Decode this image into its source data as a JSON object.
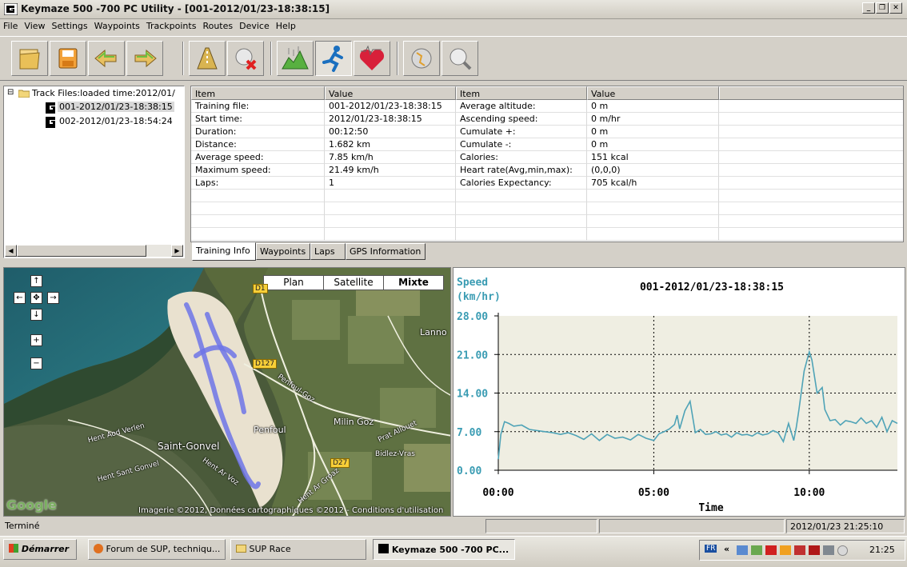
{
  "window": {
    "title": "Keymaze 500 -700 PC Utility - [001-2012/01/23-18:38:15]",
    "controls": [
      "_",
      "❐",
      "✕"
    ]
  },
  "menu": [
    "File",
    "View",
    "Settings",
    "Waypoints",
    "Trackpoints",
    "Routes",
    "Device",
    "Help"
  ],
  "toolbar": {
    "icons": [
      "open-folder-icon",
      "save-disk-icon",
      "download-arrow-icon",
      "upload-arrow-icon",
      "route-icon",
      "delete-icon",
      "altitude-chart-icon",
      "runner-icon",
      "heart-rate-icon",
      "globe-icon",
      "map-search-icon"
    ]
  },
  "tree": {
    "root_label": "Track Files:loaded time:2012/01/",
    "expander": "⊟",
    "items": [
      {
        "label": "001-2012/01/23-18:38:15"
      },
      {
        "label": "002-2012/01/23-18:54:24"
      }
    ]
  },
  "grid": {
    "headers": [
      "Item",
      "Value",
      "Item",
      "Value"
    ],
    "rows": [
      [
        "Training file:",
        "001-2012/01/23-18:38:15",
        "Average altitude:",
        "0 m"
      ],
      [
        "Start time:",
        "2012/01/23-18:38:15",
        "Ascending speed:",
        "0    m/hr"
      ],
      [
        "Duration:",
        "00:12:50",
        "Cumulate +:",
        "0 m"
      ],
      [
        "Distance:",
        "1.682 km",
        "Cumulate -:",
        "0 m"
      ],
      [
        "Average speed:",
        "7.85 km/h",
        "Calories:",
        "151  kcal"
      ],
      [
        "Maximum speed:",
        "21.49 km/h",
        "Heart rate(Avg,min,max):",
        "(0,0,0)"
      ],
      [
        "Laps:",
        "1",
        "Calories Expectancy:",
        "705  kcal/h"
      ]
    ]
  },
  "tabs": [
    "Training Info",
    "Waypoints",
    "Laps",
    "GPS Information"
  ],
  "map": {
    "modes": [
      "Plan",
      "Satellite",
      "Mixte"
    ],
    "nav": {
      "up": "↑",
      "left": "←",
      "center": "✥",
      "right": "→",
      "down": "↓",
      "zoom_in": "+",
      "zoom_out": "−"
    },
    "labels": [
      "Lanno",
      "Penfoul",
      "Penfoul-Goz",
      "Milin Goz",
      "Prat Allouet",
      "Bidlez-Vras",
      "Hent Aod Verlen",
      "Saint-Gonvel",
      "Hent Sant Gonvel",
      "Hent Ar Voz",
      "Hent Ar Groaz"
    ],
    "roads": [
      "D1",
      "D127",
      "D27"
    ],
    "logo": "Google",
    "copyright": "Imagerie ©2012, Données cartographiques ©2012 - Conditions d'utilisation"
  },
  "chart_data": {
    "type": "line",
    "title": "001-2012/01/23-18:38:15",
    "ylabel_line1": "Speed",
    "ylabel_line2": "(km/hr)",
    "xlabel": "Time",
    "yticks": [
      "28.00",
      "21.00",
      "14.00",
      "7.00",
      "0.00"
    ],
    "xticks": [
      "00:00",
      "05:00",
      "10:00"
    ],
    "ylim": [
      0,
      28
    ],
    "xlim_seconds": [
      0,
      770
    ],
    "grid": true,
    "series": [
      {
        "x": [
          0,
          5,
          12,
          20,
          30,
          45,
          60,
          75,
          90,
          105,
          120,
          135,
          150,
          165,
          180,
          195,
          210,
          225,
          240,
          255,
          270,
          285,
          300,
          310,
          320,
          330,
          340,
          345,
          350,
          360,
          370,
          380,
          390,
          400,
          410,
          420,
          430,
          440,
          450,
          460,
          470,
          480,
          490,
          500,
          510,
          520,
          530,
          540,
          550,
          560,
          570,
          575,
          580,
          590,
          600,
          605,
          615,
          625,
          630,
          640,
          650,
          660,
          670,
          680,
          690,
          700,
          710,
          720,
          730,
          740,
          750,
          760,
          770
        ],
        "y": [
          2.0,
          6.5,
          8.8,
          8.5,
          8.0,
          8.2,
          7.4,
          7.2,
          7.0,
          6.8,
          6.5,
          6.8,
          6.3,
          5.6,
          6.6,
          5.4,
          6.5,
          5.8,
          6.0,
          5.5,
          6.5,
          5.8,
          5.4,
          6.6,
          7.0,
          7.5,
          8.3,
          10.0,
          7.5,
          10.8,
          12.5,
          6.8,
          7.4,
          6.5,
          6.6,
          7.0,
          6.4,
          6.6,
          6.0,
          6.8,
          6.4,
          6.5,
          6.2,
          6.8,
          6.4,
          6.6,
          7.2,
          6.8,
          5.2,
          8.5,
          5.4,
          7.8,
          11.0,
          18.0,
          21.5,
          20.0,
          14.0,
          15.0,
          11.0,
          9.0,
          9.2,
          8.2,
          9.0,
          8.8,
          8.5,
          9.5,
          8.5,
          9.0,
          7.8,
          9.6,
          7.0,
          9.0,
          8.5
        ]
      }
    ]
  },
  "statusbar": {
    "text": "Terminé",
    "datetime": "2012/01/23 21:25:10"
  },
  "taskbar": {
    "start": "Démarrer",
    "items": [
      "Forum de SUP, techniqu...",
      "SUP Race",
      "Keymaze 500 -700 PC..."
    ],
    "tray_lang": "FR",
    "tray_chevron": "«",
    "clock": "21:25"
  },
  "colors": {
    "accent_line": "#4fa3b7",
    "chart_label": "#3a9cb3",
    "chart_bg": "#efeee2",
    "window_bg": "#d4d0c8"
  }
}
